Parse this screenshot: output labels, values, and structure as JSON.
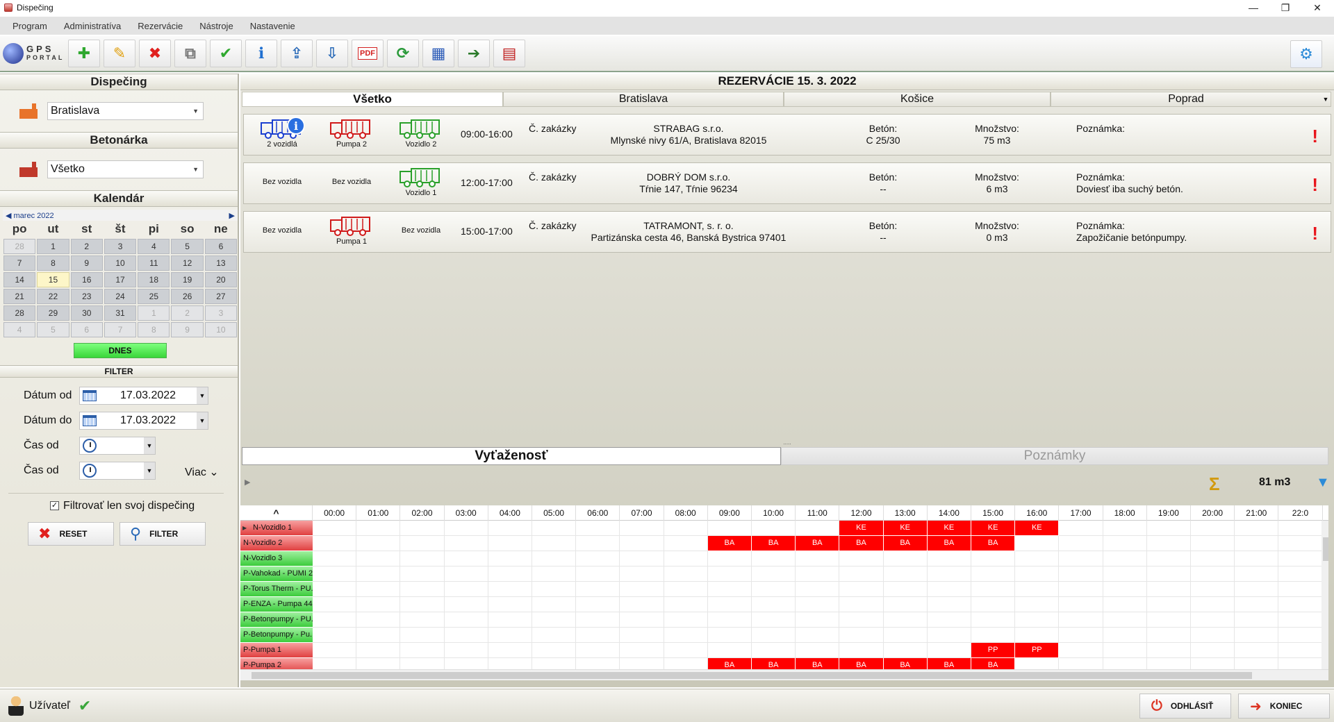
{
  "window": {
    "title": "Dispečing"
  },
  "menu": [
    "Program",
    "Administratíva",
    "Rezervácie",
    "Nástroje",
    "Nastavenie"
  ],
  "logo": {
    "line1": "GPS",
    "line2": "PORTAL"
  },
  "toolbar": [
    {
      "name": "add-icon",
      "glyph": "✚",
      "color": "#2fa82f"
    },
    {
      "name": "edit-icon",
      "glyph": "✎",
      "color": "#e0a010"
    },
    {
      "name": "delete-icon",
      "glyph": "✖",
      "color": "#e0201e"
    },
    {
      "name": "copy-icon",
      "glyph": "⧉",
      "color": "#777777"
    },
    {
      "name": "confirm-icon",
      "glyph": "✔",
      "color": "#2fa82f"
    },
    {
      "name": "info-icon",
      "glyph": "ℹ",
      "color": "#1f6fd0"
    },
    {
      "name": "export-icon",
      "glyph": "⇪",
      "color": "#2a6ab8"
    },
    {
      "name": "import-icon",
      "glyph": "⇩",
      "color": "#2a6ab8"
    },
    {
      "name": "pdf-icon",
      "glyph": "PDF",
      "color": "#d32020"
    },
    {
      "name": "refresh-icon",
      "glyph": "⟳",
      "color": "#2a9a3a"
    },
    {
      "name": "calendar-icon",
      "glyph": "▦",
      "color": "#2a5ab8"
    },
    {
      "name": "login-icon",
      "glyph": "➔",
      "color": "#2a7a2a"
    },
    {
      "name": "schedule-icon",
      "glyph": "▤",
      "color": "#c02020"
    }
  ],
  "sidebar": {
    "dispecing_title": "Dispečing",
    "dispecing_value": "Bratislava",
    "betonarka_title": "Betonárka",
    "betonarka_value": "Všetko",
    "calendar_title": "Kalendár",
    "calendar_month": "marec 2022",
    "weekdays": [
      "po",
      "ut",
      "st",
      "št",
      "pi",
      "so",
      "ne"
    ],
    "days": [
      {
        "d": "28",
        "o": true
      },
      {
        "d": "1"
      },
      {
        "d": "2"
      },
      {
        "d": "3"
      },
      {
        "d": "4"
      },
      {
        "d": "5"
      },
      {
        "d": "6"
      },
      {
        "d": "7"
      },
      {
        "d": "8"
      },
      {
        "d": "9"
      },
      {
        "d": "10"
      },
      {
        "d": "11"
      },
      {
        "d": "12"
      },
      {
        "d": "13"
      },
      {
        "d": "14"
      },
      {
        "d": "15",
        "t": true
      },
      {
        "d": "16"
      },
      {
        "d": "17"
      },
      {
        "d": "18"
      },
      {
        "d": "19"
      },
      {
        "d": "20"
      },
      {
        "d": "21"
      },
      {
        "d": "22"
      },
      {
        "d": "23"
      },
      {
        "d": "24"
      },
      {
        "d": "25"
      },
      {
        "d": "26"
      },
      {
        "d": "27"
      },
      {
        "d": "28"
      },
      {
        "d": "29"
      },
      {
        "d": "30"
      },
      {
        "d": "31"
      },
      {
        "d": "1",
        "o": true
      },
      {
        "d": "2",
        "o": true
      },
      {
        "d": "3",
        "o": true
      },
      {
        "d": "4",
        "o": true
      },
      {
        "d": "5",
        "o": true
      },
      {
        "d": "6",
        "o": true
      },
      {
        "d": "7",
        "o": true
      },
      {
        "d": "8",
        "o": true
      },
      {
        "d": "9",
        "o": true
      },
      {
        "d": "10",
        "o": true
      }
    ],
    "today_button": "DNES",
    "filter_title": "FILTER",
    "datum_od_label": "Dátum od",
    "datum_od_value": "17.03.2022",
    "datum_do_label": "Dátum do",
    "datum_do_value": "17.03.2022",
    "cas_od_label": "Čas od",
    "cas_od2_label": "Čas od",
    "viac": "Viac",
    "filter_own_label": "Filtrovať len svoj dispečing",
    "reset_button": "RESET",
    "filter_button": "FILTER"
  },
  "main": {
    "title": "REZERVÁCIE 15. 3. 2022",
    "tabs": [
      "Všetko",
      "Bratislava",
      "Košice",
      "Poprad"
    ],
    "reservations": [
      {
        "vehicles": [
          {
            "label": "2 vozidlá",
            "color": "#1a3fd0",
            "info": true
          },
          {
            "label": "Pumpa 2",
            "color": "#d01a1a"
          },
          {
            "label": "Vozidlo 2",
            "color": "#2aa02a"
          }
        ],
        "time": "09:00-16:00",
        "order_label": "Č. zakázky",
        "company": "STRABAG s.r.o.",
        "address": "Mlynské nivy 61/A, Bratislava 82015",
        "beton_label": "Betón:",
        "beton": "C 25/30",
        "mnozstvo_label": "Množstvo:",
        "mnozstvo": "75 m3",
        "poznamka_label": "Poznámka:",
        "poznamka": ""
      },
      {
        "vehicles": [
          {
            "label": "Bez vozidla",
            "none": true
          },
          {
            "label": "Bez vozidla",
            "none": true
          },
          {
            "label": "Vozidlo 1",
            "color": "#2aa02a"
          }
        ],
        "time": "12:00-17:00",
        "order_label": "Č. zakázky",
        "company": "DOBRÝ DOM s.r.o.",
        "address": "Tŕnie 147, Tŕnie 96234",
        "beton_label": "Betón:",
        "beton": "--",
        "mnozstvo_label": "Množstvo:",
        "mnozstvo": "6 m3",
        "poznamka_label": "Poznámka:",
        "poznamka": "Doviesť iba suchý betón."
      },
      {
        "vehicles": [
          {
            "label": "Bez vozidla",
            "none": true
          },
          {
            "label": "Pumpa 1",
            "color": "#d01a1a"
          },
          {
            "label": "Bez vozidla",
            "none": true
          }
        ],
        "time": "15:00-17:00",
        "order_label": "Č. zakázky",
        "company": "TATRAMONT, s. r. o.",
        "address": "Partizánska cesta 46, Banská Bystrica 97401",
        "beton_label": "Betón:",
        "beton": "--",
        "mnozstvo_label": "Množstvo:",
        "mnozstvo": "0 m3",
        "poznamka_label": "Poznámka:",
        "poznamka": "Zapožičanie betónpumpy."
      }
    ]
  },
  "lower": {
    "tab_active": "Vyťaženosť",
    "tab_inactive": "Poznámky",
    "total": "81 m3",
    "sort_glyph": "^",
    "hours": [
      "00:00",
      "01:00",
      "02:00",
      "03:00",
      "04:00",
      "05:00",
      "06:00",
      "07:00",
      "08:00",
      "09:00",
      "10:00",
      "11:00",
      "12:00",
      "13:00",
      "14:00",
      "15:00",
      "16:00",
      "17:00",
      "18:00",
      "19:00",
      "20:00",
      "21:00",
      "22:0"
    ],
    "rows": [
      {
        "name": "N-Vozidlo 1",
        "c": "r",
        "sel": true,
        "slots": {
          "12": "KE",
          "13": "KE",
          "14": "KE",
          "15": "KE",
          "16": "KE"
        }
      },
      {
        "name": "N-Vozidlo 2",
        "c": "r",
        "slots": {
          "9": "BA",
          "10": "BA",
          "11": "BA",
          "12": "BA",
          "13": "BA",
          "14": "BA",
          "15": "BA"
        }
      },
      {
        "name": "N-Vozidlo 3",
        "c": "g",
        "slots": {}
      },
      {
        "name": "P-Vahokad - PUMI 2...",
        "c": "g",
        "slots": {}
      },
      {
        "name": "P-Torus Therm - PU...",
        "c": "g",
        "slots": {}
      },
      {
        "name": "P-ENZA - Pumpa 44...",
        "c": "g",
        "slots": {}
      },
      {
        "name": "P-Betonpumpy - PU...",
        "c": "g",
        "slots": {}
      },
      {
        "name": "P-Betonpumpy - Pu...",
        "c": "g",
        "slots": {}
      },
      {
        "name": "P-Pumpa 1",
        "c": "r",
        "slots": {
          "15": "PP",
          "16": "PP"
        }
      },
      {
        "name": "P-Pumpa 2",
        "c": "r",
        "slots": {
          "9": "BA",
          "10": "BA",
          "11": "BA",
          "12": "BA",
          "13": "BA",
          "14": "BA",
          "15": "BA"
        }
      }
    ]
  },
  "status": {
    "user": "Užívateľ",
    "logout": "ODHLÁSIŤ",
    "exit": "KONIEC"
  }
}
